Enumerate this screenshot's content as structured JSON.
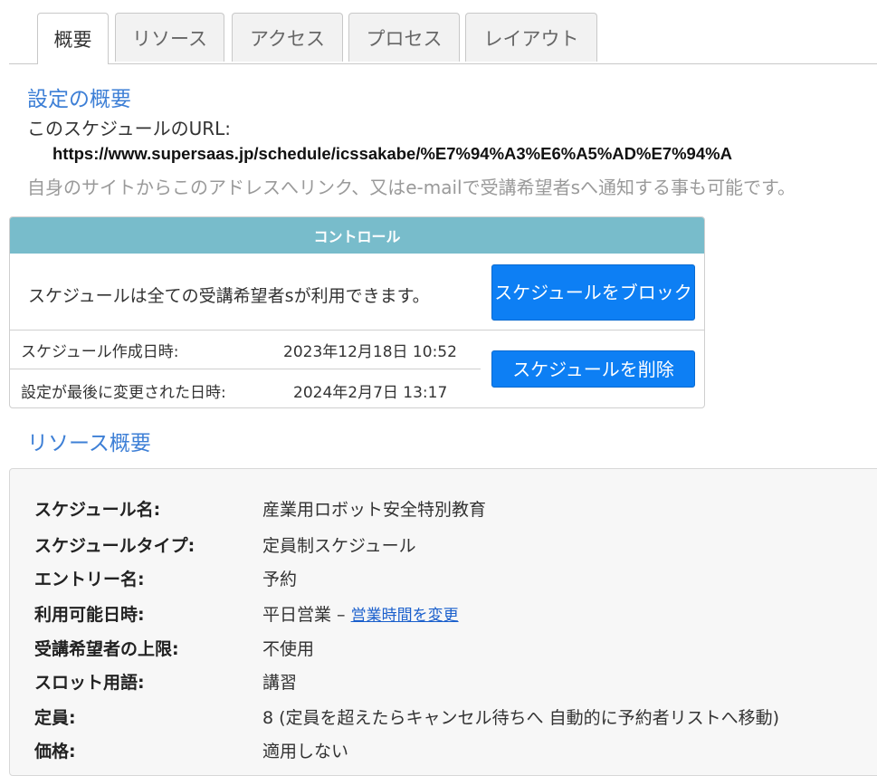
{
  "tabs": [
    {
      "label": "概要",
      "active": true
    },
    {
      "label": "リソース",
      "active": false
    },
    {
      "label": "アクセス",
      "active": false
    },
    {
      "label": "プロセス",
      "active": false
    },
    {
      "label": "レイアウト",
      "active": false
    }
  ],
  "overview": {
    "title": "設定の概要",
    "url_label": "このスケジュールのURL:",
    "url": "https://www.supersaas.jp/schedule/icssakabe/%E7%94%A3%E6%A5%AD%E7%94%A",
    "hint": "自身のサイトからこのアドレスへリンク、又はe-mailで受講希望者sへ通知する事も可能です。"
  },
  "control": {
    "header": "コントロール",
    "status": "スケジュールは全ての受講希望者sが利用できます。",
    "block_button": "スケジュールをブロック",
    "created_label": "スケジュール作成日時:",
    "created_value": "2023年12月18日 10:52",
    "modified_label": "設定が最後に変更された日時:",
    "modified_value": "2024年2月7日 13:17",
    "delete_button": "スケジュールを削除"
  },
  "resource_summary": {
    "title": "リソース概要",
    "rows": [
      {
        "label": "スケジュール名:",
        "value": "産業用ロボット安全特別教育"
      },
      {
        "label": "スケジュールタイプ:",
        "value": "定員制スケジュール"
      },
      {
        "label": "エントリー名:",
        "value": "予約"
      },
      {
        "label": "利用可能日時:",
        "value": "平日営業 – ",
        "link": "営業時間を変更"
      },
      {
        "label": "受講希望者の上限:",
        "value": "不使用"
      },
      {
        "label": "スロット用語:",
        "value": "講習"
      },
      {
        "label": "定員:",
        "value": "8 (定員を超えたらキャンセル待ちへ 自動的に予約者リストへ移動)"
      },
      {
        "label": "価格:",
        "value": "適用しない"
      }
    ]
  },
  "colors": {
    "accent_blue": "#3d7fd6",
    "button_blue": "#0d7ff4",
    "panel_header": "#78bccb"
  }
}
